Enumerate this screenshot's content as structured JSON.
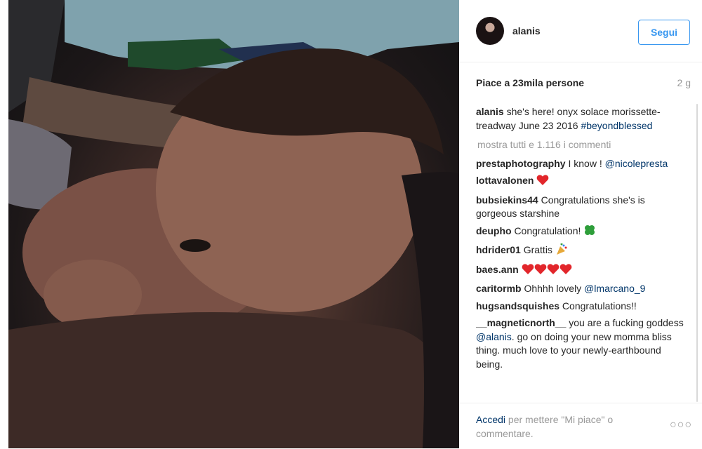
{
  "post": {
    "image_alt": "Foto del post"
  },
  "header": {
    "username": "alanis",
    "follow_label": "Segui"
  },
  "stats": {
    "likes": "Piace a 23mila persone",
    "age": "2 g"
  },
  "caption": {
    "username": "alanis",
    "text": "she's here! onyx solace morissette-treadway June 23 2016",
    "hashtag": "#beyondblessed"
  },
  "view_all": "mostra tutti e 1.116 i commenti",
  "comments": [
    {
      "user": "prestaphotography",
      "text": "I know !",
      "mention": "@nicolepresta"
    },
    {
      "user": "lottavalonen",
      "text": "",
      "emoji": [
        "heart-icon"
      ]
    },
    {
      "user": "bubsiekins44",
      "text": "Congratulations she's is gorgeous starshine"
    },
    {
      "user": "deupho",
      "text": "Congratulation!",
      "emoji": [
        "four-leaf-clover-icon"
      ]
    },
    {
      "user": "hdrider01",
      "text": "Grattis",
      "emoji": [
        "party-popper-icon"
      ]
    },
    {
      "user": "baes.ann",
      "text": "",
      "emoji": [
        "heart-icon",
        "heart-icon",
        "heart-icon",
        "heart-icon"
      ]
    },
    {
      "user": "caritormb",
      "text": "Ohhhh lovely",
      "mention": "@lmarcano_9"
    },
    {
      "user": "hugsandsquishes",
      "text": "Congratulations!!"
    },
    {
      "user": "__magneticnorth__",
      "text": "you are a fucking goddess",
      "mention": "@alanis",
      "text_after": ". go on doing your new momma bliss thing. much love to your newly-earthbound being."
    }
  ],
  "footer": {
    "login_link": "Accedi",
    "login_rest": "per mettere \"Mi piace\" o commentare.",
    "more_label": "○○○"
  },
  "colors": {
    "link_blue": "#3897f0",
    "dark_link": "#003569",
    "heart_red": "#e2262b",
    "clover_green": "#2e9e3a"
  }
}
